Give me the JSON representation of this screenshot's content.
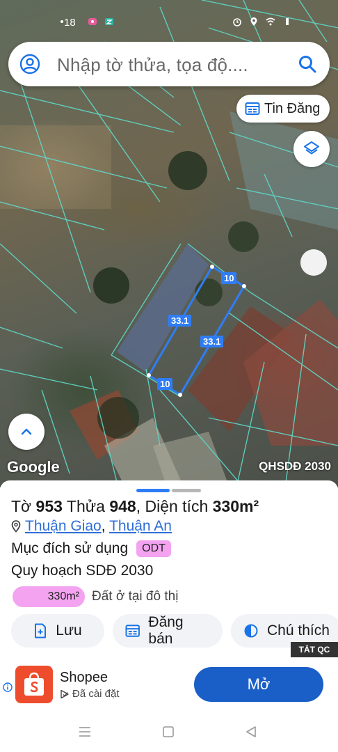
{
  "status_bar": {
    "time": "18"
  },
  "search": {
    "placeholder": "Nhập tờ thửa, tọa độ...."
  },
  "map": {
    "tin_dang_label": "Tin Đăng",
    "google_label": "Google",
    "planning_label": "QHSDĐ 2030",
    "plot_dimensions": {
      "top": "10",
      "left": "33.1",
      "right": "33.1",
      "bottom": "10"
    },
    "boundary_color": "#2f7df6",
    "cadastral_line_color": "#5fd8c8"
  },
  "parcel": {
    "to_label": "Tờ",
    "to_number": "953",
    "thua_label": "Thửa",
    "thua_number": "948",
    "area_label": "Diện tích",
    "area_value": "330m²",
    "ward": "Thuận Giao",
    "separator": ",",
    "district": "Thuận An",
    "purpose_label": "Mục đích sử dụng",
    "purpose_code": "ODT",
    "plan_label": "Quy hoạch SDĐ 2030",
    "land_use_area": "330m²",
    "land_use_desc": "Đất ở tại đô thị",
    "land_use_color": "#f3a3f0"
  },
  "actions": {
    "save": "Lưu",
    "sell": "Đăng bán",
    "legend": "Chú thích"
  },
  "ad": {
    "dismiss": "TẮT QC",
    "app_name": "Shopee",
    "status": "Đã cài đặt",
    "open": "Mở",
    "brand_color": "#ee4d2d"
  }
}
